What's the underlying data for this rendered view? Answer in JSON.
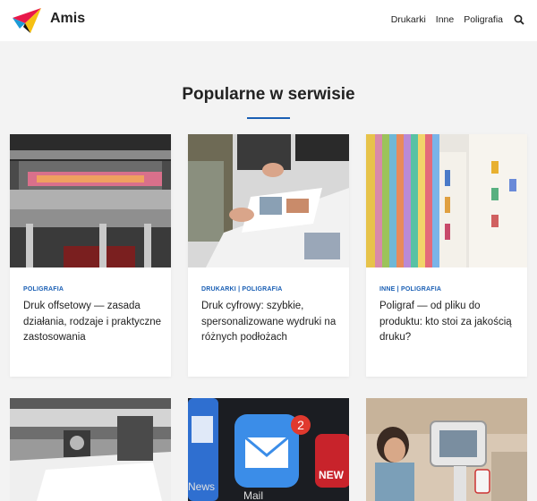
{
  "site": {
    "name": "Amis"
  },
  "nav": {
    "items": [
      "Drukarki",
      "Inne",
      "Poligrafia"
    ]
  },
  "section": {
    "title": "Popularne w serwisie"
  },
  "colors": {
    "accent": "#1a5fb4",
    "header_bg": "#ffffff",
    "page_bg": "#f3f3f3"
  },
  "posts": [
    {
      "category": "POLIGRAFIA",
      "title": "Druk offsetowy — zasada działania, rodzaje i praktyczne zastosowania",
      "image": "offset-press-photo"
    },
    {
      "category": "DRUKARKI | POLIGRAFIA",
      "title": "Druk cyfrowy: szybkie, spersonalizowane wydruki na różnych podłożach",
      "image": "magazines-on-table-photo"
    },
    {
      "category": "INNE | POLIGRAFIA",
      "title": "Poligraf — od pliku do produktu: kto stoi za jakością druku?",
      "image": "color-swatches-photo"
    },
    {
      "image": "printing-machine-photo"
    },
    {
      "image": "phone-apps-photo",
      "badge": "2",
      "app_label_mail": "Mail",
      "app_label_news": "News"
    },
    {
      "image": "kiosk-tablet-photo"
    }
  ]
}
